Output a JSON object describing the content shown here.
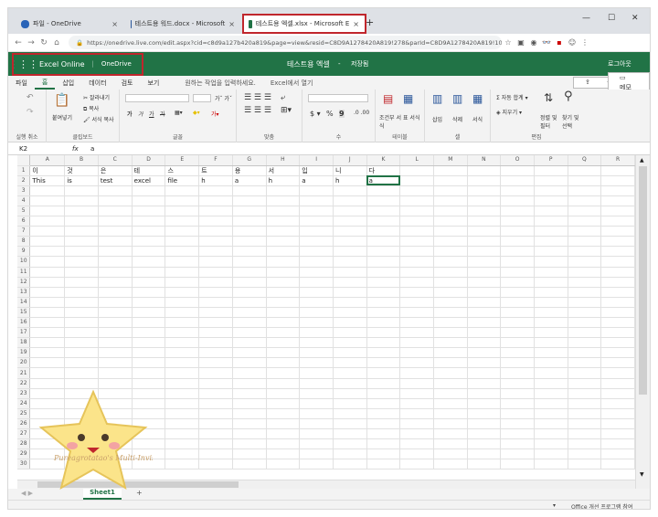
{
  "browser": {
    "tabs": [
      {
        "title": "파일 - OneDrive",
        "icon": "onedrive-cloud-icon"
      },
      {
        "title": "테스트용 워드.docx - Microsoft",
        "icon": "word-icon"
      },
      {
        "title": "테스트용 엑셀.xlsx - Microsoft E",
        "icon": "excel-icon"
      }
    ],
    "new_tab": "+",
    "url": "https://onedrive.live.com/edit.aspx?cid=c8d9a127b420a819&page=view&resid=C8D9A1278420A819!278&parId=C8D9A1278420A819!101..."
  },
  "appbar": {
    "app_name": "Excel Online",
    "service": "OneDrive",
    "doc_title": "테스트용 엑셀",
    "separator": "-",
    "save_state": "저장됨",
    "sign_out": "로그아웃"
  },
  "ribbon_tabs": [
    "파일",
    "홈",
    "삽입",
    "데이터",
    "검토",
    "보기"
  ],
  "tell_me": "원하는 작업을 입력하세요.",
  "open_in_excel": "Excel에서 열기",
  "share": "공유",
  "comments": "메모",
  "ribbon": {
    "clipboard": {
      "paste": "붙여넣기",
      "cut": "잘라내기",
      "copy": "복사",
      "format_painter": "서식 복사",
      "label": "클립보드"
    },
    "undo_label": "실행 취소",
    "font": {
      "bold": "가",
      "italic": "가",
      "underline": "가",
      "strike": "가",
      "label": "글꼴"
    },
    "alignment": {
      "label": "맞춤"
    },
    "number": {
      "currency": "$",
      "percent": "%",
      "label": "수"
    },
    "tables": {
      "cond": "조건부 서식",
      "table": "표 서식",
      "label": "테이블"
    },
    "cells": {
      "insert": "삽입",
      "delete": "삭제",
      "format": "서식",
      "label": "셀"
    },
    "editing": {
      "autosum": "자동 합계",
      "clear": "지우기",
      "sort": "정렬 및 필터",
      "find": "찾기 및 선택",
      "label": "편집"
    }
  },
  "formula_bar": {
    "name_box": "K2",
    "fx": "fx",
    "value": "a"
  },
  "columns": [
    "A",
    "B",
    "C",
    "D",
    "E",
    "F",
    "G",
    "H",
    "I",
    "J",
    "K",
    "L",
    "M",
    "N",
    "O",
    "P",
    "Q",
    "R"
  ],
  "row1": [
    "이",
    "것",
    "은",
    "테",
    "스",
    "트",
    "용",
    "서",
    "입",
    "니",
    "다"
  ],
  "row2": [
    "This",
    "is",
    "test",
    "excel",
    "file",
    "h",
    "a",
    "h",
    "a",
    "h",
    "a"
  ],
  "sheet_tab": "Sheet1",
  "add_sheet": "+",
  "status_text": "Office 개선 프로그램 참여",
  "watermark": "Pureagrotatao's Multi-Invisibility"
}
